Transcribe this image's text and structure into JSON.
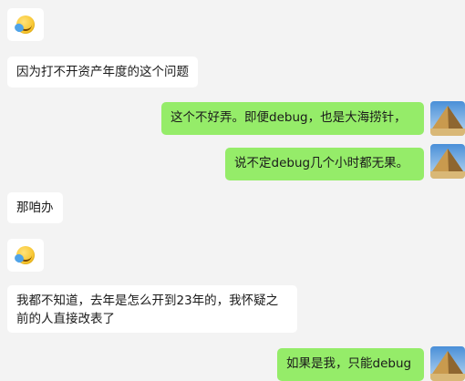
{
  "messages": [
    {
      "side": "left",
      "type": "emoji",
      "emoji": "grinning-sweat-icon"
    },
    {
      "side": "left",
      "type": "text",
      "text": "因为打不开资产年度的这个问题"
    },
    {
      "side": "right",
      "type": "text",
      "text": "这个不好弄。即便debug，也是大海捞针，"
    },
    {
      "side": "right",
      "type": "text",
      "text": "说不定debug几个小时都无果。"
    },
    {
      "side": "left",
      "type": "text",
      "text": "那咱办"
    },
    {
      "side": "left",
      "type": "emoji",
      "emoji": "grinning-sweat-icon"
    },
    {
      "side": "left",
      "type": "text",
      "text": "我都不知道，去年是怎么开到23年的，我怀疑之前的人直接改表了"
    },
    {
      "side": "right",
      "type": "text",
      "text": "如果是我，只能debug"
    }
  ],
  "colors": {
    "background": "#f3f3f3",
    "left_bubble": "#ffffff",
    "right_bubble": "#95ec69"
  },
  "avatar_icon": "pyramid-avatar-icon"
}
